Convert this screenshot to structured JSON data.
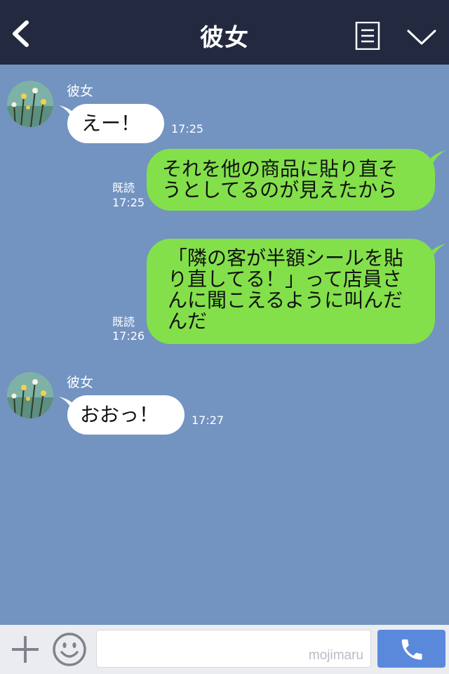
{
  "header": {
    "title": "彼女"
  },
  "messages": [
    {
      "sender": "彼女",
      "text": "えー！",
      "time": "17:25"
    },
    {
      "read_label": "既読",
      "time": "17:25",
      "lines": [
        "それを他の商品に貼り直そ",
        "うとしてるのが見えたから"
      ]
    },
    {
      "read_label": "既読",
      "time": "17:26",
      "lines": [
        "「隣の客が半額シールを貼",
        "り直してる！」って店員さ",
        "んに聞こえるように叫んだ",
        "んだ"
      ]
    },
    {
      "sender": "彼女",
      "text": "おおっ！",
      "time": "17:27"
    }
  ],
  "footer": {
    "input_value": "",
    "watermark": "mojimaru"
  },
  "colors": {
    "header_bg": "#232a3f",
    "chat_bg": "#7393c1",
    "incoming_bubble": "#ffffff",
    "outgoing_bubble": "#83e04a",
    "call_button": "#5a89dc"
  },
  "icons": {
    "back": "chevron-left-icon",
    "menu": "menu-list-icon",
    "collapse": "chevron-down-icon",
    "plus": "plus-icon",
    "emoji": "smiley-icon",
    "call": "phone-icon"
  }
}
